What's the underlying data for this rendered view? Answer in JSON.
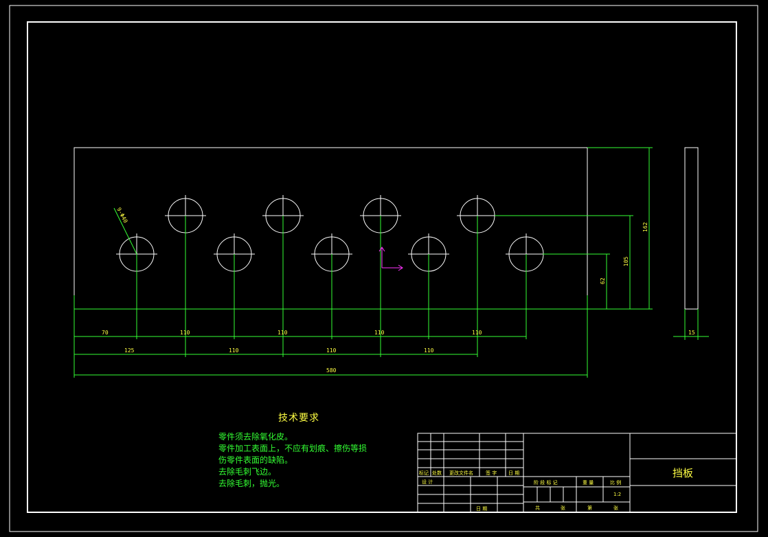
{
  "colors": {
    "background": "#000000",
    "frame": "#ffffff",
    "dimension": "#33ff33",
    "text_yellow": "#ffff44",
    "ucs": "#ff33ff"
  },
  "technical_requirements": {
    "title": "技术要求",
    "notes": [
      "零件须去除氧化皮。",
      "零件加工表面上，不应有划痕、擦伤等损",
      "伤零件表面的缺陷。",
      "去除毛刺飞边。",
      "去除毛刺，抛光。"
    ]
  },
  "title_block": {
    "part_name": "挡板",
    "scale": "1:2",
    "headers": {
      "mark": "标记",
      "count": "处数",
      "file_no": "更改文件名",
      "sign": "签 字",
      "date": "日 期",
      "design": "设 计",
      "date2": "日 期",
      "stage_mark": "阶 段 标 记",
      "weight": "重 量",
      "ratio": "比 例",
      "total": "共",
      "sheet": "张",
      "page": "第",
      "page_sheet": "张"
    }
  },
  "dimensions": {
    "hole_callout": "9-Φ40",
    "top_row": [
      "70",
      "110",
      "110",
      "110",
      "110"
    ],
    "second_row": [
      "125",
      "110",
      "110",
      "110"
    ],
    "overall_length": "580",
    "height_lower_holes": "62",
    "height_upper_holes": "105",
    "overall_height": "162",
    "thickness": "15"
  }
}
